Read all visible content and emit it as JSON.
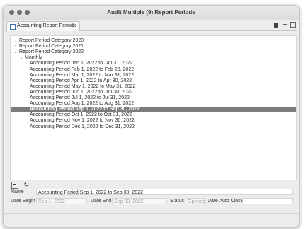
{
  "window": {
    "title": "Audit Multiple (9) Report Periods"
  },
  "tab": {
    "label": "Accounting Report Period",
    "close": "✕"
  },
  "tree": {
    "rows": [
      {
        "label": "Report Period Category 2020",
        "chevron": "›",
        "expanded": false,
        "depth": 0
      },
      {
        "label": "Report Period Category 2021",
        "chevron": "›",
        "expanded": false,
        "depth": 0
      },
      {
        "label": "Report Period Category 2022",
        "chevron": "⌄",
        "expanded": true,
        "depth": 0
      },
      {
        "label": "Monthly",
        "chevron": "⌄",
        "expanded": true,
        "depth": 1
      },
      {
        "label": "Accounting Period Jan 1, 2022 to Jan 31, 2022",
        "depth": 2
      },
      {
        "label": "Accounting Period Feb 1, 2022 to Feb 28, 2022",
        "depth": 2
      },
      {
        "label": "Accounting Period Mar 1, 2022 to Mar 31, 2022",
        "depth": 2
      },
      {
        "label": "Accounting Period Apr 1, 2022 to Apr 30, 2022",
        "depth": 2
      },
      {
        "label": "Accounting Period May 1, 2022 to May 31, 2022",
        "depth": 2
      },
      {
        "label": "Accounting Period Jun 1, 2022 to Jun 30, 2022",
        "depth": 2
      },
      {
        "label": "Accounting Period Jul 1, 2022 to Jul 31, 2022",
        "depth": 2
      },
      {
        "label": "Accounting Period Aug 1, 2022 to Aug 31, 2022",
        "depth": 2
      },
      {
        "label": "Accounting Period Sep 1, 2022 to Sep 30, 2022",
        "depth": 2,
        "selected": true
      },
      {
        "label": "Accounting Period Oct 1, 2022 to Oct 31, 2022",
        "depth": 2
      },
      {
        "label": "Accounting Period Nov 1, 2022 to Nov 30, 2022",
        "depth": 2
      },
      {
        "label": "Accounting Period Dec 1, 2022 to Dec 31, 2022",
        "depth": 2
      }
    ]
  },
  "toolbar": {
    "refresh_glyph": "↻"
  },
  "form": {
    "name_label": "Name",
    "name_value": "Accounting Period Sep 1, 2022 to Sep 30, 2022",
    "date_begin_label": "Date Begin",
    "date_begin_value": "Sep 1, 2022",
    "date_end_label": "Date End",
    "date_end_value": "Sep 30, 2022",
    "status_label": "Status",
    "status_value": "Opened",
    "date_auto_close_label": "Date Auto Close",
    "date_auto_close_value": ""
  },
  "colors": {
    "selection": "#7c7c7c",
    "traffic_light": "#6e6e6e"
  }
}
